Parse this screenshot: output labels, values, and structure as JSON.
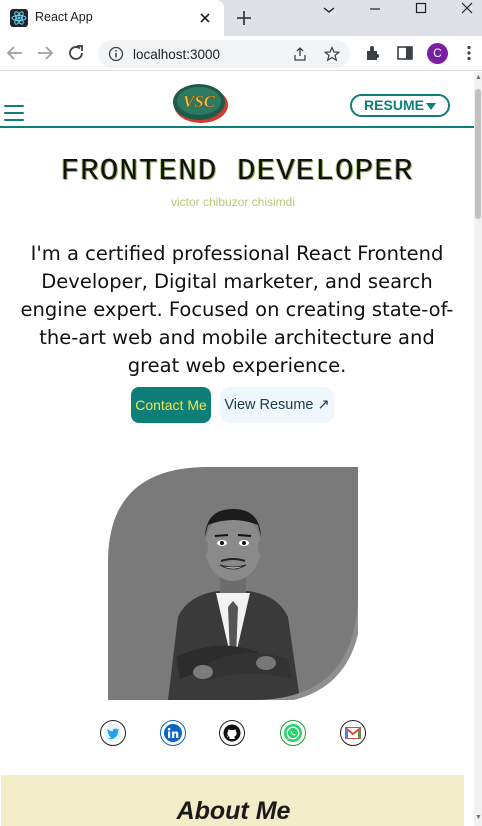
{
  "browser": {
    "tab_title": "React App",
    "url": "localhost:3000",
    "profile_initial": "C"
  },
  "header": {
    "logo_text": "VSC",
    "resume_label": "RESUME"
  },
  "hero": {
    "title": "FRONTEND DEVELOPER",
    "subtitle": "victor chibuzor chisimdi",
    "description": "I'm a certified professional React Frontend Developer, Digital marketer, and search engine expert. Focused on creating state-of-the-art web and mobile architecture and great web experience.",
    "contact_label": "Contact Me",
    "view_resume_label": "View Resume ↗"
  },
  "socials": [
    "twitter-icon",
    "linkedin-icon",
    "github-icon",
    "whatsapp-icon",
    "gmail-icon"
  ],
  "about": {
    "title": "About Me"
  },
  "colors": {
    "accent": "#0e7f78",
    "contact_text": "#f5e44b",
    "subtitle": "#b8c874",
    "about_bg": "#f3ecc8"
  }
}
